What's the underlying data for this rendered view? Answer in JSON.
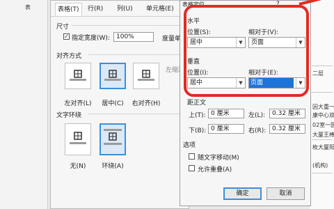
{
  "background": {
    "left_label": "表",
    "right_items": [
      "二层",
      "因大重一",
      "康中心双",
      "02室一园",
      "大厦王棒",
      "枚大厦阳",
      "(机构)"
    ]
  },
  "table_props": {
    "tabs": [
      "表格(T)",
      "行(R)",
      "列(U)",
      "单元格(E)"
    ],
    "size_group": "尺寸",
    "pref_width_label": "指定宽度(W):",
    "pref_width_value": "100%",
    "measure_label": "度量单位",
    "align_group": "对齐方式",
    "align_options": [
      "左对齐(L)",
      "居中(C)",
      "右对齐(H)"
    ],
    "indent_label": "左缩进",
    "wrap_group": "文字环绕",
    "wrap_options": [
      "无(N)",
      "环绕(A)"
    ]
  },
  "positioning": {
    "title": "表格定位",
    "close_glyph": "?",
    "horizontal": "水平",
    "horiz_pos_label": "位置(S):",
    "horiz_pos_value": "居中",
    "horiz_rel_label": "相对于(V):",
    "horiz_rel_value": "页面",
    "vertical": "垂直",
    "vert_pos_label": "位置(I):",
    "vert_pos_value": "居中",
    "vert_rel_label": "相对于(E):",
    "vert_rel_value": "页面",
    "distance_group": "距正文",
    "top_label": "上(T):",
    "top_value": "0 厘米",
    "bottom_label": "下(B):",
    "bottom_value": "0 厘米",
    "left_label": "左(L):",
    "left_value": "0.32 厘米",
    "right_label": "右(R):",
    "right_value": "0.32 厘米",
    "options_group": "选项",
    "move_with_text": "随文字移动(M)",
    "allow_overlap": "允许重叠(A)",
    "ok": "确定",
    "cancel": "取消"
  },
  "colors": {
    "annotation": "#e22b22",
    "highlight": "#1e73d8"
  }
}
